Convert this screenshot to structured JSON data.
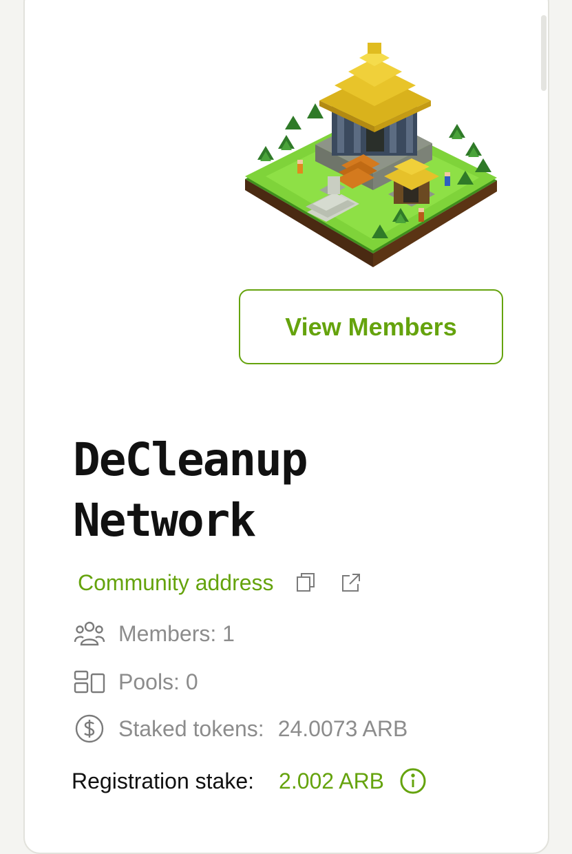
{
  "community": {
    "name": "DeCleanup Network",
    "view_members_label": "View Members",
    "address_label": "Community address",
    "members_text": "Members: 1",
    "pools_text": "Pools: 0",
    "staked_label": "Staked tokens:",
    "staked_value": "24.0073 ARB",
    "registration_label": "Registration stake:",
    "registration_value": "2.002 ARB"
  },
  "icons": {
    "copy": "copy-icon",
    "external": "external-link-icon",
    "members": "users-icon",
    "pools": "layout-icon",
    "staked": "dollar-circle-icon",
    "info": "info-icon"
  },
  "colors": {
    "accent": "#65a30d",
    "title": "#111111",
    "muted": "#8c8c8c",
    "background": "#f4f4f1",
    "card": "#ffffff"
  }
}
